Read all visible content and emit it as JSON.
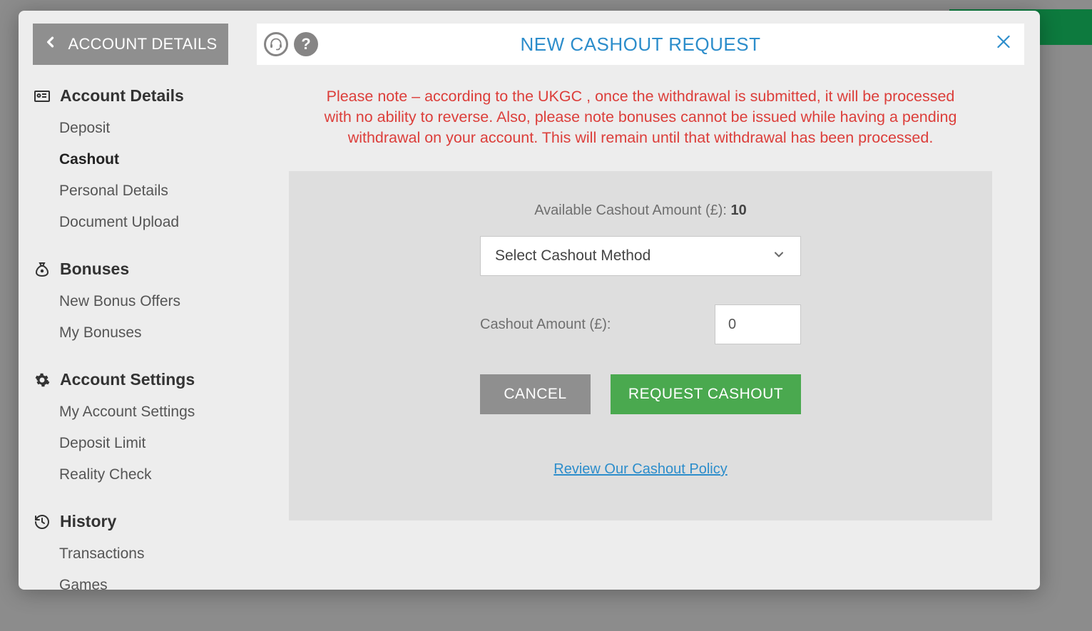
{
  "sidebar": {
    "back_label": "ACCOUNT DETAILS",
    "groups": [
      {
        "title": "Account Details",
        "icon": "id-card-icon",
        "items": [
          {
            "label": "Deposit",
            "active": false
          },
          {
            "label": "Cashout",
            "active": true
          },
          {
            "label": "Personal Details",
            "active": false
          },
          {
            "label": "Document Upload",
            "active": false
          }
        ]
      },
      {
        "title": "Bonuses",
        "icon": "money-bag-icon",
        "items": [
          {
            "label": "New Bonus Offers",
            "active": false
          },
          {
            "label": "My Bonuses",
            "active": false
          }
        ]
      },
      {
        "title": "Account Settings",
        "icon": "gear-icon",
        "items": [
          {
            "label": "My Account Settings",
            "active": false
          },
          {
            "label": "Deposit Limit",
            "active": false
          },
          {
            "label": "Reality Check",
            "active": false
          }
        ]
      },
      {
        "title": "History",
        "icon": "history-icon",
        "items": [
          {
            "label": "Transactions",
            "active": false
          },
          {
            "label": "Games",
            "active": false
          }
        ]
      }
    ]
  },
  "header": {
    "title": "NEW CASHOUT REQUEST"
  },
  "content": {
    "warning": "Please note – according to the UKGC , once the withdrawal is submitted, it will be processed with no ability to reverse. Also, please note bonuses cannot be issued while having a pending withdrawal on your account. This will remain until that withdrawal has been processed.",
    "available_label": "Available Cashout Amount (£): ",
    "available_value": "10",
    "method_placeholder": "Select Cashout Method",
    "amount_label": "Cashout Amount (£):",
    "amount_value": "0",
    "cancel_label": "CANCEL",
    "request_label": "REQUEST CASHOUT",
    "policy_label": "Review Our Cashout Policy"
  }
}
